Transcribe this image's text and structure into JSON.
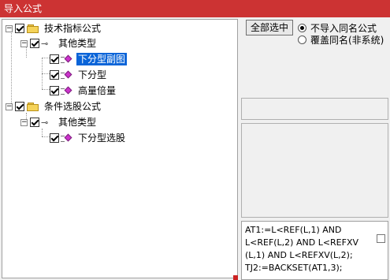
{
  "window": {
    "title": "导入公式"
  },
  "tree": {
    "groups": [
      {
        "label": "技术指标公式",
        "subgroups": [
          {
            "label": "其他类型",
            "items": [
              {
                "label": "下分型副图",
                "selected": true
              },
              {
                "label": "下分型",
                "selected": false
              },
              {
                "label": "高量倍量",
                "selected": false
              }
            ]
          }
        ]
      },
      {
        "label": "条件选股公式",
        "subgroups": [
          {
            "label": "其他类型",
            "items": [
              {
                "label": "下分型选股",
                "selected": false
              }
            ]
          }
        ]
      }
    ]
  },
  "controls": {
    "select_all_label": "全部选中",
    "radio_options": [
      {
        "label": "不导入同名公式",
        "checked": true
      },
      {
        "label": "覆盖同名(非系统)",
        "checked": false
      }
    ]
  },
  "code_preview": {
    "lines": [
      "AT1:=L<REF(L,1) AND",
      "L<REF(L,2) AND L<REFXV",
      "(L,1) AND L<REFXV(L,2);",
      "TJ2:=BACKSET(AT1,3);"
    ]
  },
  "colors": {
    "titlebar": "#cc3333",
    "selection": "#0a64d8",
    "folder": "#f5d35a",
    "formula_icon": "#cc33cc"
  }
}
